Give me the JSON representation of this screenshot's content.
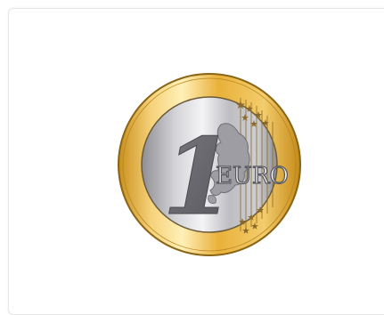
{
  "coin": {
    "denomination": "1",
    "currency": "EURO"
  },
  "colors": {
    "page_background": "#ffffff",
    "card_border": "#e6e6e6",
    "ring_gold": "#e8b53b",
    "center_silver": "#b8b8bc",
    "engraving": "#6d6d73"
  }
}
